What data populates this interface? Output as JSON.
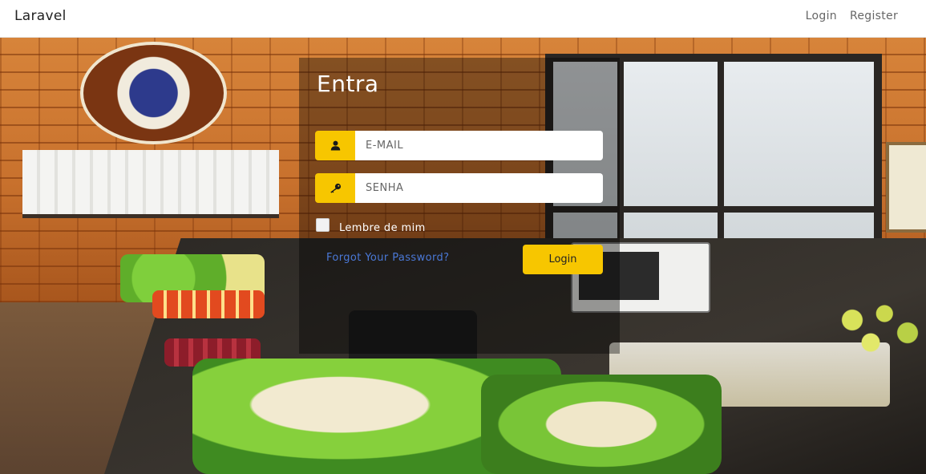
{
  "navbar": {
    "brand": "Laravel",
    "links": [
      "Login",
      "Register"
    ]
  },
  "login_form": {
    "title": "Entra",
    "email_placeholder": "E-MAIL",
    "password_placeholder": "SENHA",
    "remember_label": "Lembre de mim",
    "forgot_link": "Forgot Your Password?",
    "submit_label": "Login",
    "email_icon": "user-icon",
    "password_icon": "key-icon",
    "accent_color": "#f7c600"
  }
}
